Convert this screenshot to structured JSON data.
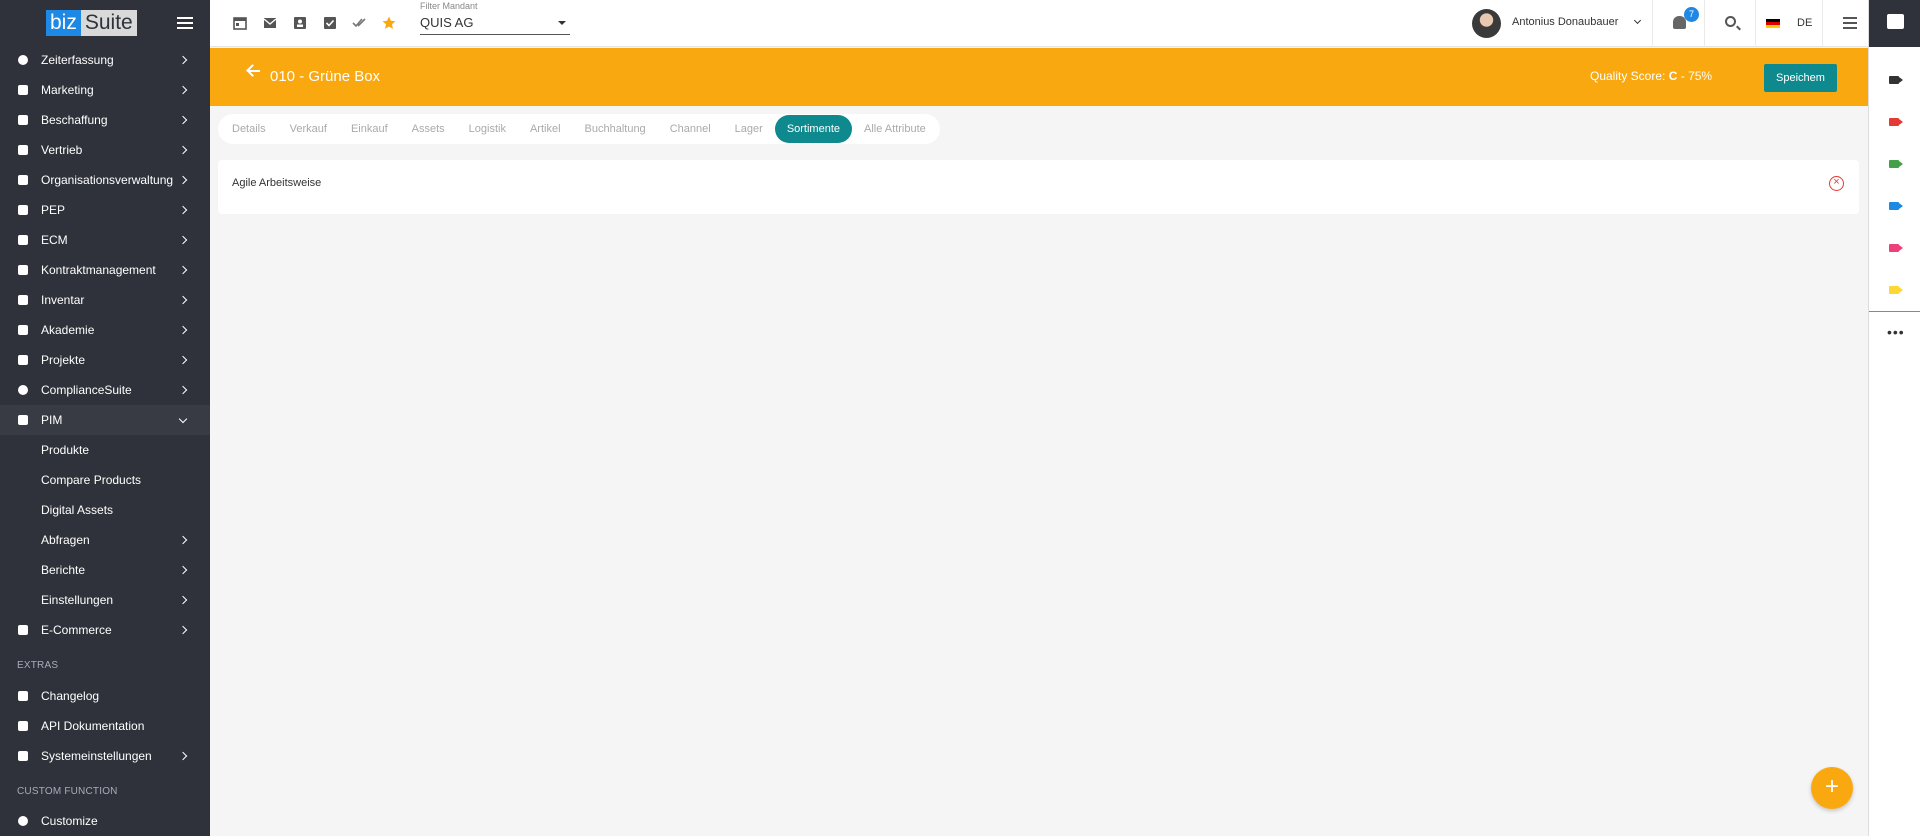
{
  "app": {
    "logo_left": "biz",
    "logo_right": "Suite"
  },
  "sidebar": {
    "items": [
      {
        "label": "Zeiterfassung",
        "icon": "clock-icon"
      },
      {
        "label": "Marketing",
        "icon": "marketing-icon"
      },
      {
        "label": "Beschaffung",
        "icon": "truck-icon"
      },
      {
        "label": "Vertrieb",
        "icon": "people-icon"
      },
      {
        "label": "Organisationsverwaltung",
        "icon": "org-icon"
      },
      {
        "label": "PEP",
        "icon": "group-icon"
      },
      {
        "label": "ECM",
        "icon": "archive-icon"
      },
      {
        "label": "Kontraktmanagement",
        "icon": "briefcase-icon"
      },
      {
        "label": "Inventar",
        "icon": "lock-icon"
      },
      {
        "label": "Akademie",
        "icon": "school-icon"
      },
      {
        "label": "Projekte",
        "icon": "project-icon"
      },
      {
        "label": "ComplianceSuite",
        "icon": "shield-icon"
      },
      {
        "label": "PIM",
        "icon": "pim-icon"
      }
    ],
    "pim_sub": [
      {
        "label": "Produkte"
      },
      {
        "label": "Compare Products"
      },
      {
        "label": "Digital Assets"
      },
      {
        "label": "Abfragen"
      },
      {
        "label": "Berichte"
      },
      {
        "label": "Einstellungen"
      }
    ],
    "ecommerce": {
      "label": "E-Commerce",
      "icon": "cart-icon"
    },
    "extras_head": "EXTRAS",
    "extras": [
      {
        "label": "Changelog",
        "icon": "doc-icon"
      },
      {
        "label": "API Dokumentation",
        "icon": "folder-icon"
      },
      {
        "label": "Systemeinstellungen",
        "icon": "lock-icon"
      }
    ],
    "custom_head": "CUSTOM FUNCTION",
    "custom": {
      "label": "Customize",
      "icon": "gear-icon"
    }
  },
  "topbar": {
    "filter_label": "Filter Mandant",
    "filter_value": "QUIS AG",
    "username": "Antonius Donaubauer",
    "notification_count": "7",
    "language": "DE"
  },
  "page": {
    "title": "010 - Grüne Box",
    "quality_label": "Quality Score:",
    "quality_grade": "C",
    "quality_sep": "-",
    "quality_percent": "75%",
    "save_label": "Speichem"
  },
  "tabs": [
    {
      "label": "Details"
    },
    {
      "label": "Verkauf"
    },
    {
      "label": "Einkauf"
    },
    {
      "label": "Assets"
    },
    {
      "label": "Logistik"
    },
    {
      "label": "Artikel"
    },
    {
      "label": "Buchhaltung"
    },
    {
      "label": "Channel"
    },
    {
      "label": "Lager"
    },
    {
      "label": "Sortimente"
    },
    {
      "label": "Alle Attribute"
    }
  ],
  "active_tab": "Sortimente",
  "card": {
    "text": "Agile Arbeitsweise"
  },
  "colors": {
    "accent": "#f9a80f",
    "teal": "#0e8a8e",
    "sidebar": "#2f323a",
    "danger": "#e53935",
    "badge": "#1e88e5"
  },
  "right_panel": {
    "cameras": [
      "#333333",
      "#e53935",
      "#43a047",
      "#1e88e5",
      "#ec407a",
      "#fdd835"
    ]
  }
}
